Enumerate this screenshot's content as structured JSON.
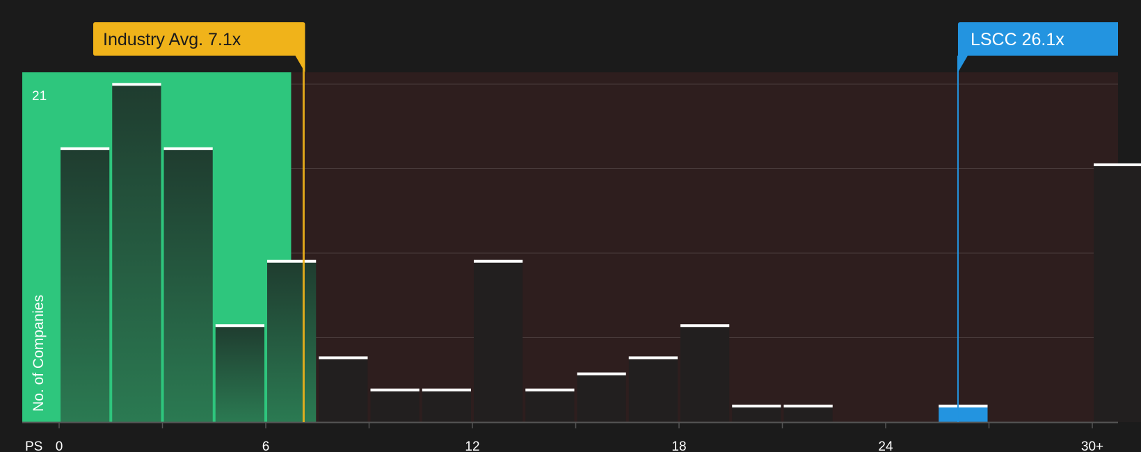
{
  "chart_data": {
    "type": "bar",
    "xlabel": "PS",
    "ylabel": "No. of Companies",
    "y_max_label": "21",
    "ylim": [
      0,
      21.75
    ],
    "x_ticks": [
      {
        "value": 0,
        "label": "0"
      },
      {
        "value": 6,
        "label": "6"
      },
      {
        "value": 12,
        "label": "12"
      },
      {
        "value": 18,
        "label": "18"
      },
      {
        "value": 24,
        "label": "24"
      },
      {
        "value": 30,
        "label": "30+"
      }
    ],
    "bins": [
      {
        "start": 0,
        "end": 1.5,
        "value": 17,
        "zone": "below"
      },
      {
        "start": 1.5,
        "end": 3,
        "value": 21,
        "zone": "below"
      },
      {
        "start": 3,
        "end": 4.5,
        "value": 17,
        "zone": "below"
      },
      {
        "start": 4.5,
        "end": 6,
        "value": 6,
        "zone": "below"
      },
      {
        "start": 6,
        "end": 7.5,
        "value": 10,
        "zone": "below"
      },
      {
        "start": 7.5,
        "end": 9,
        "value": 4,
        "zone": "above"
      },
      {
        "start": 9,
        "end": 10.5,
        "value": 2,
        "zone": "above"
      },
      {
        "start": 10.5,
        "end": 12,
        "value": 2,
        "zone": "above"
      },
      {
        "start": 12,
        "end": 13.5,
        "value": 10,
        "zone": "above"
      },
      {
        "start": 13.5,
        "end": 15,
        "value": 2,
        "zone": "above"
      },
      {
        "start": 15,
        "end": 16.5,
        "value": 3,
        "zone": "above"
      },
      {
        "start": 16.5,
        "end": 18,
        "value": 4,
        "zone": "above"
      },
      {
        "start": 18,
        "end": 19.5,
        "value": 6,
        "zone": "above"
      },
      {
        "start": 19.5,
        "end": 21,
        "value": 1,
        "zone": "above"
      },
      {
        "start": 21,
        "end": 22.5,
        "value": 1,
        "zone": "above"
      },
      {
        "start": 22.5,
        "end": 24,
        "value": 0,
        "zone": "above"
      },
      {
        "start": 24,
        "end": 25.5,
        "value": 0,
        "zone": "above"
      },
      {
        "start": 25.5,
        "end": 27,
        "value": 1,
        "zone": "highlight"
      },
      {
        "start": 27,
        "end": 28.5,
        "value": 0,
        "zone": "above"
      },
      {
        "start": 28.5,
        "end": 30,
        "value": 0,
        "zone": "above"
      },
      {
        "start": 30,
        "end": 31.5,
        "value": 16,
        "zone": "above"
      }
    ],
    "markers": [
      {
        "name": "industry-avg",
        "label": "Industry Avg. 7.1x",
        "value": 7.1,
        "color": "#f0b31a"
      },
      {
        "name": "lscc",
        "label": "LSCC 26.1x",
        "value": 26.1,
        "color": "#2394e0"
      }
    ],
    "colors": {
      "background": "#1b1b1b",
      "below_zone": "#2ec67d",
      "above_zone": "#2e1e1e",
      "bar_below": "#234b37",
      "bar_above": "#221f1f",
      "bar_highlight": "#2394e0",
      "bar_cap": "#ffffff",
      "grid": "#4a3c3c",
      "axis": "#555555"
    }
  }
}
